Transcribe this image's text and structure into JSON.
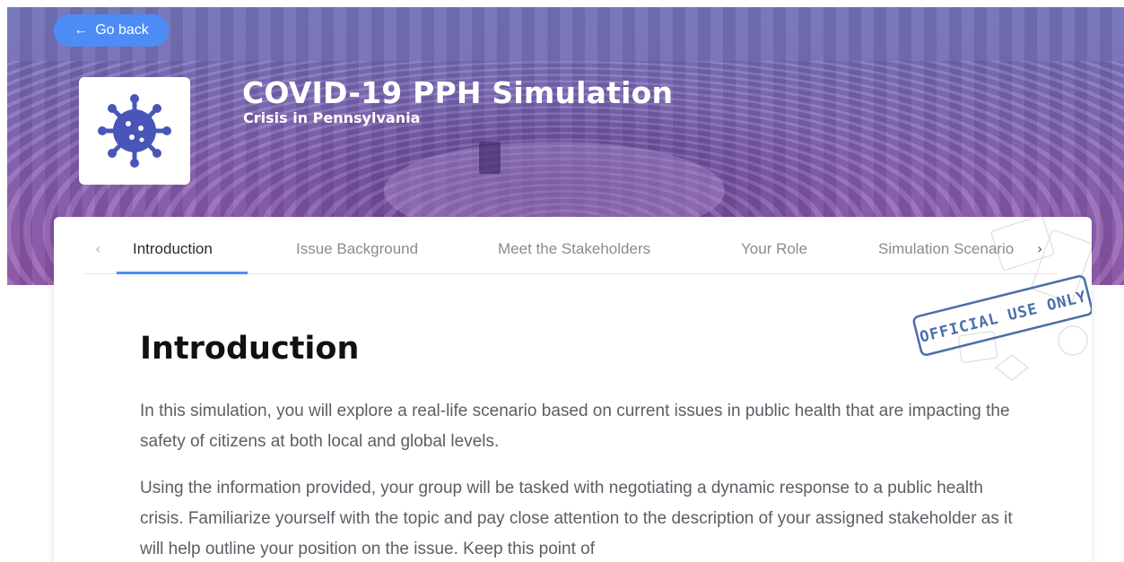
{
  "header": {
    "go_back_label": "Go back",
    "title": "COVID-19 PPH Simulation",
    "subtitle": "Crisis in Pennsylvania",
    "logo_icon": "virus-icon"
  },
  "tabs": {
    "items": [
      {
        "label": "Introduction",
        "active": true
      },
      {
        "label": "Issue Background",
        "active": false
      },
      {
        "label": "Meet the Stakeholders",
        "active": false
      },
      {
        "label": "Your Role",
        "active": false
      },
      {
        "label": "Simulation Scenario",
        "active": false
      }
    ]
  },
  "stamp": {
    "text": "OFFICIAL USE ONLY"
  },
  "content": {
    "heading": "Introduction",
    "paragraphs": [
      "In this simulation, you will explore a real-life scenario based on current issues in public health that are impacting the safety of citizens at both local and global levels.",
      "Using the information provided, your group will be tasked with negotiating a dynamic response to a public health crisis. Familiarize yourself with the topic and pay close attention to the description of your assigned stakeholder as it will help outline your position on the issue. Keep this point of"
    ]
  },
  "colors": {
    "accent": "#4d8cf5",
    "logo": "#4a55b8",
    "stamp": "#4a6fa8"
  }
}
